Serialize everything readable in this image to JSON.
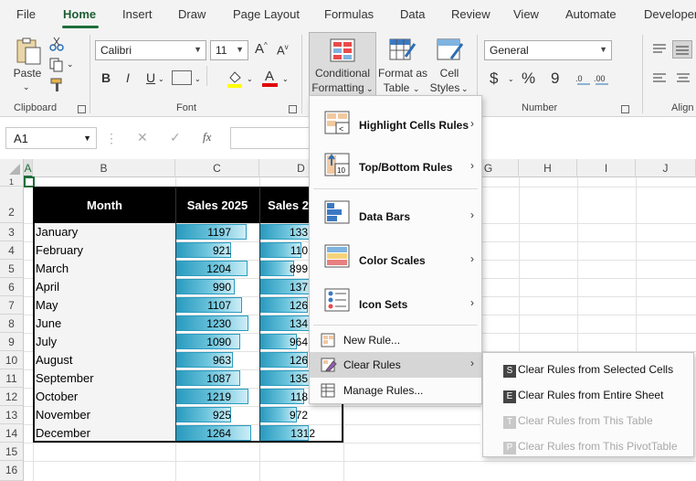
{
  "tabs": [
    "File",
    "Home",
    "Insert",
    "Draw",
    "Page Layout",
    "Formulas",
    "Data",
    "Review",
    "View",
    "Automate",
    "Developer"
  ],
  "ribbon": {
    "clipboard": {
      "paste_label": "Paste",
      "group_label": "Clipboard"
    },
    "font": {
      "font_name": "Calibri",
      "font_size": "11",
      "bold": "B",
      "italic": "I",
      "underline": "U",
      "grow": "A",
      "shrink": "A",
      "font_color_glyph": "A",
      "group_label": "Font"
    },
    "styles": {
      "cf_label_1": "Conditional",
      "cf_label_2": "Formatting",
      "fat_label_1": "Format as",
      "fat_label_2": "Table",
      "cs_label_1": "Cell",
      "cs_label_2": "Styles"
    },
    "number": {
      "format": "General",
      "currency": "$",
      "percent": "%",
      "comma": "9",
      "group_label": "Number"
    },
    "alignment": {
      "group_label": "Align"
    }
  },
  "namebox": {
    "value": "A1"
  },
  "fx_label": "fx",
  "columns": [
    "A",
    "B",
    "C",
    "D",
    "E",
    "F",
    "G",
    "H",
    "I",
    "J"
  ],
  "rows": [
    "1",
    "2",
    "3",
    "4",
    "5",
    "6",
    "7",
    "8",
    "9",
    "10",
    "11",
    "12",
    "13",
    "14",
    "15",
    "16"
  ],
  "table": {
    "headers": [
      "Month",
      "Sales 2025",
      "Sales 2"
    ],
    "months": [
      "January",
      "February",
      "March",
      "April",
      "May",
      "June",
      "July",
      "August",
      "September",
      "October",
      "November",
      "December"
    ],
    "sales2025": [
      1197,
      921,
      1204,
      990,
      1107,
      1230,
      1090,
      963,
      1087,
      1219,
      925,
      1264
    ],
    "sales2024_visible": [
      "133",
      "110",
      "899",
      "137",
      "126",
      "134",
      "964",
      "126",
      "135",
      "118",
      "972",
      "1312"
    ],
    "sales2024_fill": [
      0.63,
      0.52,
      0.43,
      0.65,
      0.6,
      0.64,
      0.46,
      0.6,
      0.64,
      0.56,
      0.46,
      0.62
    ]
  },
  "cf_menu": {
    "items": [
      {
        "label": "Highlight Cells Rules",
        "submenu": true
      },
      {
        "label": "Top/Bottom Rules",
        "submenu": true
      },
      {
        "label": "Data Bars",
        "submenu": true
      },
      {
        "label": "Color Scales",
        "submenu": true
      },
      {
        "label": "Icon Sets",
        "submenu": true
      },
      {
        "label": "New Rule...",
        "submenu": false
      },
      {
        "label": "Clear Rules",
        "submenu": true
      },
      {
        "label": "Manage Rules...",
        "submenu": false
      }
    ],
    "icon_text_topbottom": "10"
  },
  "clear_submenu": {
    "items": [
      {
        "label": "Clear Rules from Selected Cells",
        "badge": "S",
        "enabled": true
      },
      {
        "label": "Clear Rules from Entire Sheet",
        "badge": "E",
        "enabled": true
      },
      {
        "label": "Clear Rules from This Table",
        "badge": "T",
        "enabled": false
      },
      {
        "label": "Clear Rules from This PivotTable",
        "badge": "P",
        "enabled": false
      }
    ]
  },
  "colors": {
    "excel_green": "#1e6e3b",
    "bar_blue": "#2a9bbf",
    "menu_hover": "#d6d6d6"
  }
}
